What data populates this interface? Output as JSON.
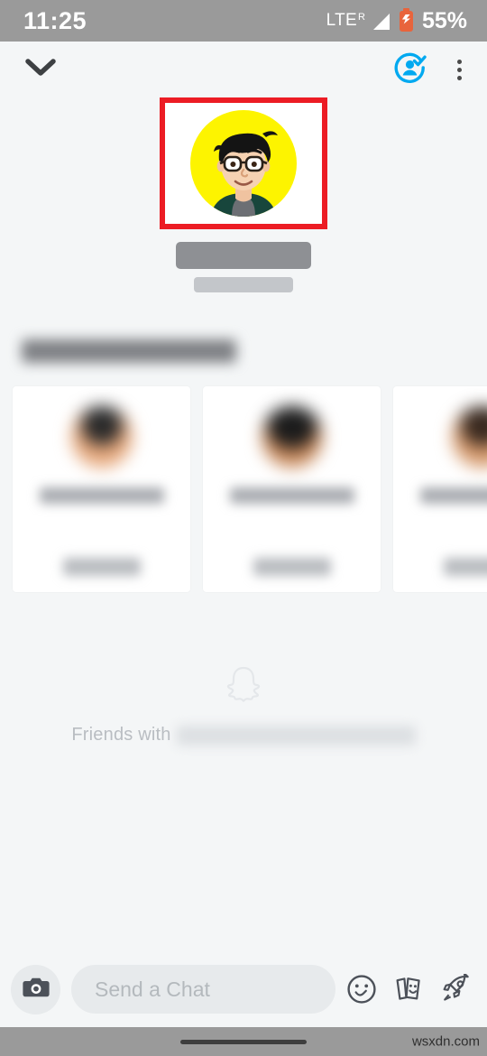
{
  "status_bar": {
    "time": "11:25",
    "network_label": "LTE",
    "roaming_indicator": "R",
    "signal_icon": "signal-bars-icon",
    "battery_icon": "battery-charging-icon",
    "battery_percent": "55%",
    "background_color": "#9a9a9a",
    "text_color": "#ffffff"
  },
  "top_nav": {
    "back_icon": "chevron-down-icon",
    "friend_added_icon": "friend-added-check-icon",
    "friend_added_color": "#00a9f0",
    "overflow_icon": "more-vertical-icon"
  },
  "profile": {
    "avatar_icon": "bitmoji-avatar",
    "avatar_background_color": "#fdf400",
    "annotation": {
      "type": "red-rectangle-highlight",
      "color": "#ec1c24",
      "border_width": "6px"
    },
    "display_name_redacted": true,
    "username_redacted": true
  },
  "suggestions": {
    "heading_redacted": true,
    "cards": [
      {
        "avatar_icon": "person-avatar",
        "name_redacted": true,
        "action_label_redacted": true
      },
      {
        "avatar_icon": "person-avatar",
        "name_redacted": true,
        "action_label_redacted": true
      },
      {
        "avatar_icon": "person-avatar",
        "name_redacted": true,
        "action_label_redacted": true
      }
    ]
  },
  "friends_with": {
    "ghost_icon": "snapchat-ghost-icon",
    "label": "Friends with",
    "names_redacted": true
  },
  "chat_bar": {
    "camera_icon": "camera-icon",
    "input_placeholder": "Send a Chat",
    "icons": [
      {
        "name": "smiley-sticker-icon"
      },
      {
        "name": "sticker-cards-icon"
      },
      {
        "name": "rocket-icon"
      }
    ]
  },
  "nav_bar": {
    "home_pill_icon": "home-indicator-pill",
    "watermark": "wsxdn.com",
    "background_color": "#9a9a9a"
  }
}
